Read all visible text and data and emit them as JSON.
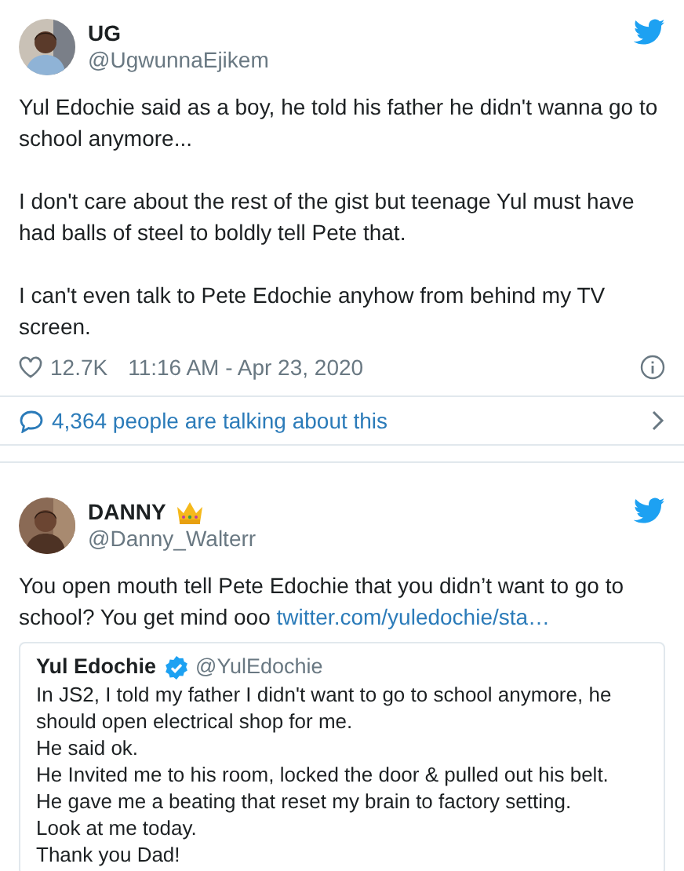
{
  "tweets": [
    {
      "name": "UG",
      "handle": "@UgwunnaEjikem",
      "paragraphs": [
        "Yul Edochie said as a boy, he told his father he didn't wanna go to school anymore...",
        "I don't care about the rest of the gist but teenage Yul must have had balls of steel to boldly tell Pete that.",
        "I can't even talk to Pete Edochie anyhow from behind my TV screen."
      ],
      "likes": "12.7K",
      "timestamp": "11:16 AM - Apr 23, 2020",
      "talking": "4,364 people are talking about this"
    },
    {
      "name": "DANNY",
      "crown": true,
      "handle": "@Danny_Walterr",
      "paragraphs": [
        "You open mouth tell Pete Edochie that you didn’t want to go to school? You get mind ooo"
      ],
      "link": "twitter.com/yuledochie/sta…",
      "quote": {
        "name": "Yul Edochie",
        "verified": true,
        "handle": "@YulEdochie",
        "lines": [
          "In JS2, I told my father I didn't want to go to school anymore, he should open electrical shop for me.",
          "He said ok.",
          "He Invited me to his room, locked the door & pulled out his belt.",
          "He gave me a beating that reset my brain to factory setting.",
          "Look at me today.",
          "Thank you Dad!"
        ]
      }
    }
  ]
}
